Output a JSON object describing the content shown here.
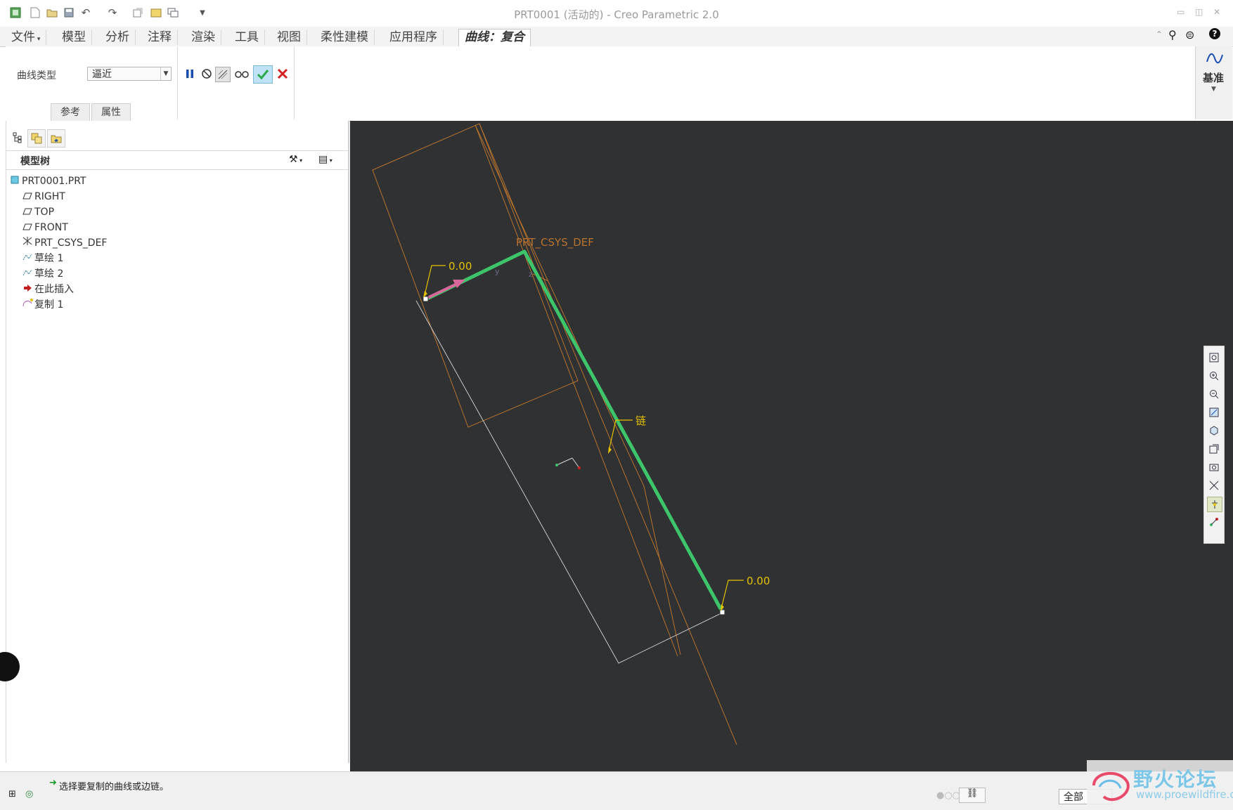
{
  "window": {
    "title": "PRT0001 (活动的) - Creo Parametric 2.0"
  },
  "quick_access": {
    "icons": [
      "app-icon",
      "new-icon",
      "open-icon",
      "save-icon",
      "undo-icon",
      "redo-icon",
      "regenerate-icon",
      "windows-icon",
      "close-window-icon",
      "customize-icon"
    ]
  },
  "tabs": [
    {
      "label": "文件"
    },
    {
      "label": "模型"
    },
    {
      "label": "分析"
    },
    {
      "label": "注释"
    },
    {
      "label": "渲染"
    },
    {
      "label": "工具"
    },
    {
      "label": "视图"
    },
    {
      "label": "柔性建模"
    },
    {
      "label": "应用程序"
    },
    {
      "label": "曲线：复合"
    }
  ],
  "ribbon": {
    "curve_type_label": "曲线类型",
    "curve_type_value": "逼近",
    "subtabs": [
      "参考",
      "属性"
    ],
    "datum_label": "基准",
    "colors": {
      "ok": "#2aa84a",
      "cancel": "#d42020",
      "pause": "#1a4fb0"
    }
  },
  "model_tree": {
    "title": "模型树",
    "items": [
      {
        "label": "PRT0001.PRT",
        "icon": "part-icon"
      },
      {
        "label": "RIGHT",
        "icon": "datum-plane-icon"
      },
      {
        "label": "TOP",
        "icon": "datum-plane-icon"
      },
      {
        "label": "FRONT",
        "icon": "datum-plane-icon"
      },
      {
        "label": "PRT_CSYS_DEF",
        "icon": "csys-icon"
      },
      {
        "label": "草绘 1",
        "icon": "sketch-icon"
      },
      {
        "label": "草绘 2",
        "icon": "sketch-icon"
      },
      {
        "label": "在此插入",
        "icon": "insert-here-icon"
      },
      {
        "label": "复制 1",
        "icon": "copy-feature-icon"
      }
    ]
  },
  "viewport": {
    "background": "#2f3133",
    "csys_label": "PRT_CSYS_DEF",
    "start_value": "0.00",
    "end_value": "0.00",
    "chain_label": "链",
    "colors": {
      "curve": "#3ec46a",
      "datum": "#b8732e",
      "annotation": "#e6c200",
      "outline": "#c8c8c8",
      "direction": "#d8689a"
    }
  },
  "status": {
    "message": "选择要复制的曲线或边链。",
    "filter_value": "全部"
  },
  "watermark": {
    "text": "野火论坛",
    "url": "www.proewildfire.cn"
  }
}
